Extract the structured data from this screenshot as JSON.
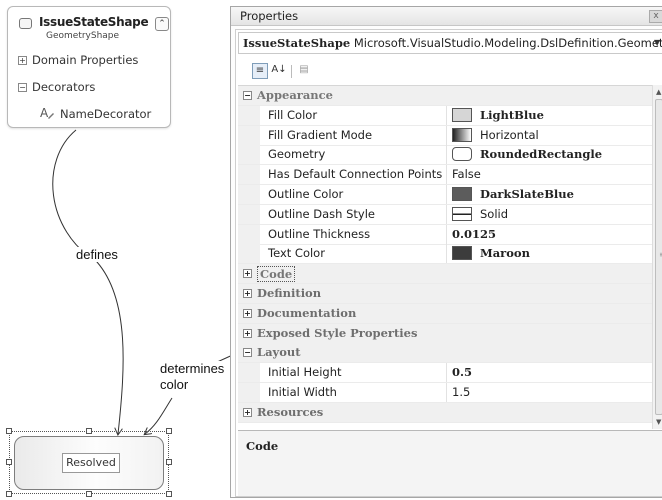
{
  "shape_card": {
    "title": "IssueStateShape",
    "subtitle": "GeometryShape",
    "collapse_glyph": "⌃",
    "sections": [
      {
        "toggle": "+",
        "label": "Domain Properties"
      },
      {
        "toggle": "−",
        "label": "Decorators"
      }
    ],
    "decorator": {
      "icon": "text-decorator-icon",
      "label": "NameDecorator"
    }
  },
  "annotations": {
    "defines": "defines",
    "determines_line1": "determines",
    "determines_line2": "color"
  },
  "resolved_shape": {
    "label": "Resolved"
  },
  "properties": {
    "title": "Properties",
    "close_glyph": "x",
    "object_name": "IssueStateShape",
    "object_type": "Microsoft.VisualStudio.Modeling.DslDefinition.Geometr",
    "toolbar": {
      "categorized_glyph": "≡",
      "alphabetical_glyph": "A↓",
      "pages_glyph": "▤"
    },
    "rows": [
      {
        "kind": "cat",
        "toggle": "−",
        "label": "Appearance"
      },
      {
        "kind": "prop",
        "name": "Fill Color",
        "value": "LightBlue",
        "swatch": "#d6d6d6",
        "bold": true
      },
      {
        "kind": "prop",
        "name": "Fill Gradient Mode",
        "value": "Horizontal",
        "swatch": "gradient",
        "bold": false
      },
      {
        "kind": "prop",
        "name": "Geometry",
        "value": "RoundedRectangle",
        "swatch": "rounded",
        "bold": true
      },
      {
        "kind": "prop",
        "name": "Has Default Connection Points",
        "value": "False",
        "swatch": "",
        "bold": false
      },
      {
        "kind": "prop",
        "name": "Outline Color",
        "value": "DarkSlateBlue",
        "swatch": "#5c5c5c",
        "bold": true
      },
      {
        "kind": "prop",
        "name": "Outline Dash Style",
        "value": "Solid",
        "swatch": "line",
        "bold": false
      },
      {
        "kind": "prop",
        "name": "Outline Thickness",
        "value": "0.0125",
        "swatch": "",
        "bold": true
      },
      {
        "kind": "prop",
        "name": "Text Color",
        "value": "Maroon",
        "swatch": "#3c3c3c",
        "bold": true
      },
      {
        "kind": "cat",
        "toggle": "+",
        "label": "Code",
        "focused": true
      },
      {
        "kind": "cat",
        "toggle": "+",
        "label": "Definition"
      },
      {
        "kind": "cat",
        "toggle": "+",
        "label": "Documentation"
      },
      {
        "kind": "cat",
        "toggle": "+",
        "label": "Exposed Style Properties"
      },
      {
        "kind": "cat",
        "toggle": "−",
        "label": "Layout"
      },
      {
        "kind": "prop",
        "name": "Initial Height",
        "value": "0.5",
        "swatch": "",
        "bold": true
      },
      {
        "kind": "prop",
        "name": "Initial Width",
        "value": "1.5",
        "swatch": "",
        "bold": false
      },
      {
        "kind": "cat",
        "toggle": "+",
        "label": "Resources"
      }
    ],
    "scroll": {
      "up": "▲",
      "down": "▼",
      "grip": "≡"
    },
    "description_title": "Code"
  }
}
